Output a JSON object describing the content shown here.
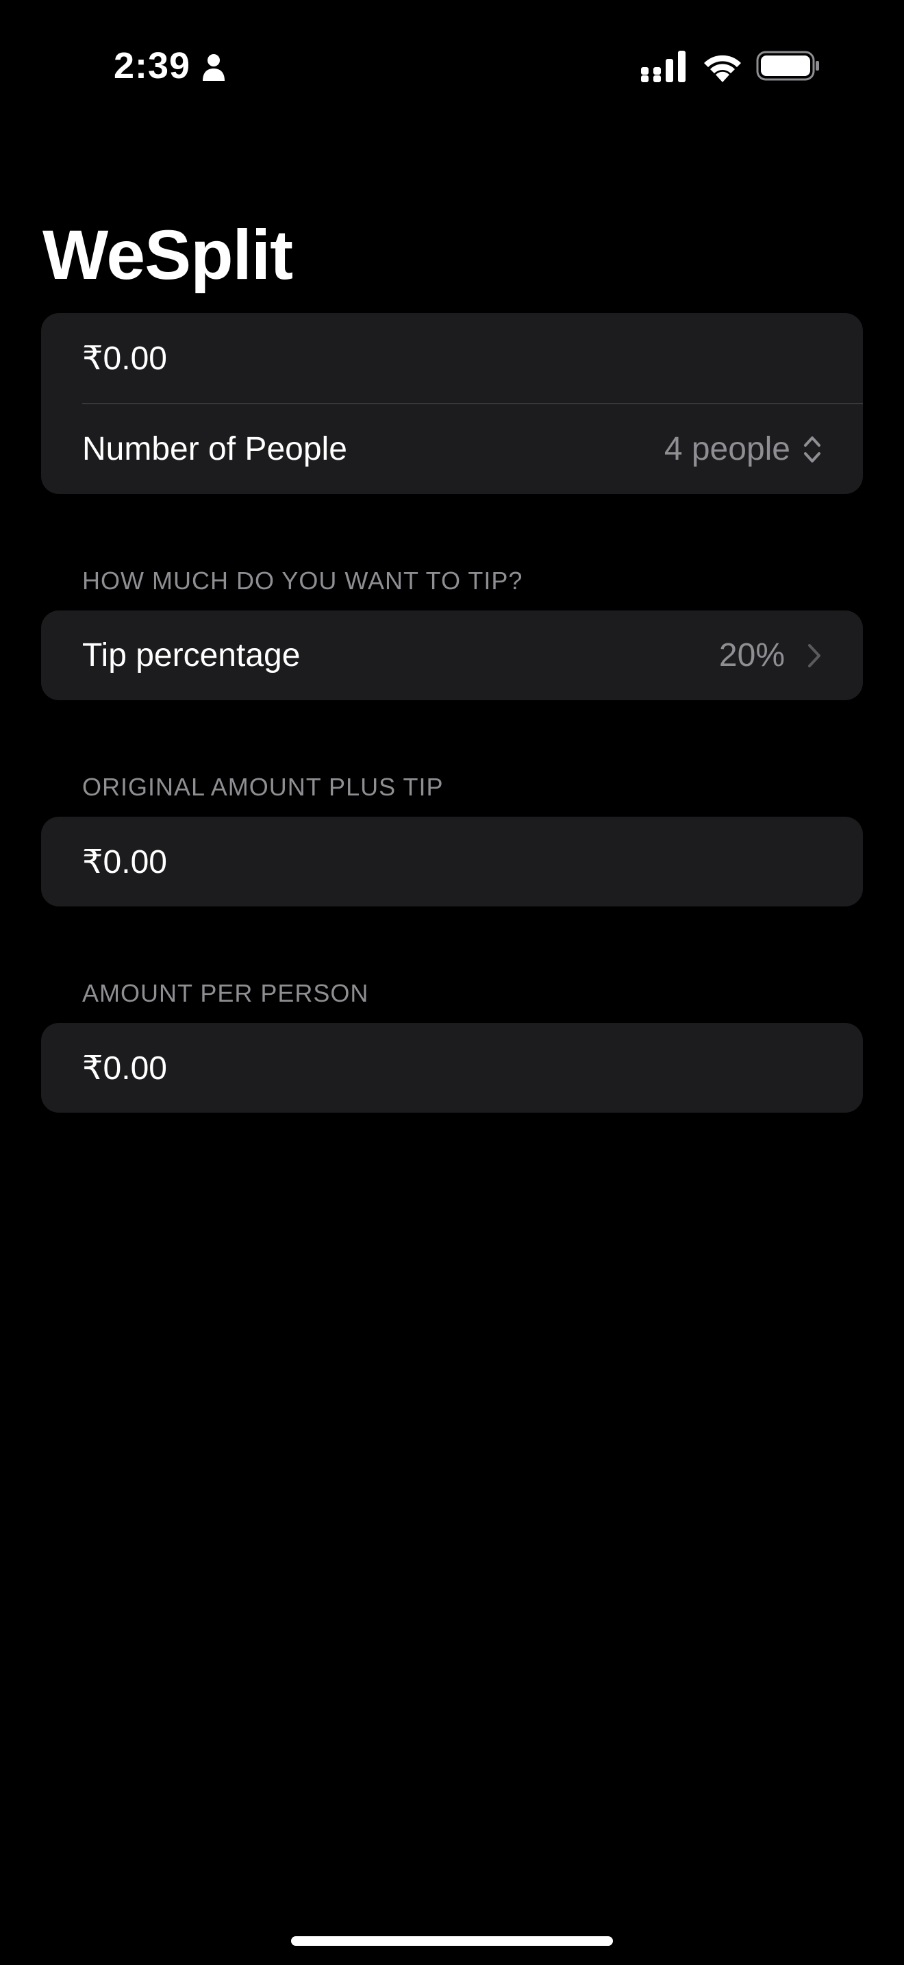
{
  "status_bar": {
    "time": "2:39",
    "icons": [
      "person-icon",
      "cellular-signal-icon",
      "wifi-icon",
      "battery-icon"
    ]
  },
  "title": "WeSplit",
  "form": {
    "amount_value": "₹0.00",
    "people_label": "Number of People",
    "people_value": "4 people",
    "tip_header": "HOW MUCH DO YOU WANT TO TIP?",
    "tip_label": "Tip percentage",
    "tip_value": "20%",
    "total_header": "ORIGINAL AMOUNT PLUS TIP",
    "total_value": "₹0.00",
    "per_person_header": "AMOUNT PER PERSON",
    "per_person_value": "₹0.00"
  },
  "colors": {
    "background": "#000000",
    "group_background": "#1c1c1e",
    "secondary_text": "#8e8e93",
    "separator": "#38383a"
  }
}
